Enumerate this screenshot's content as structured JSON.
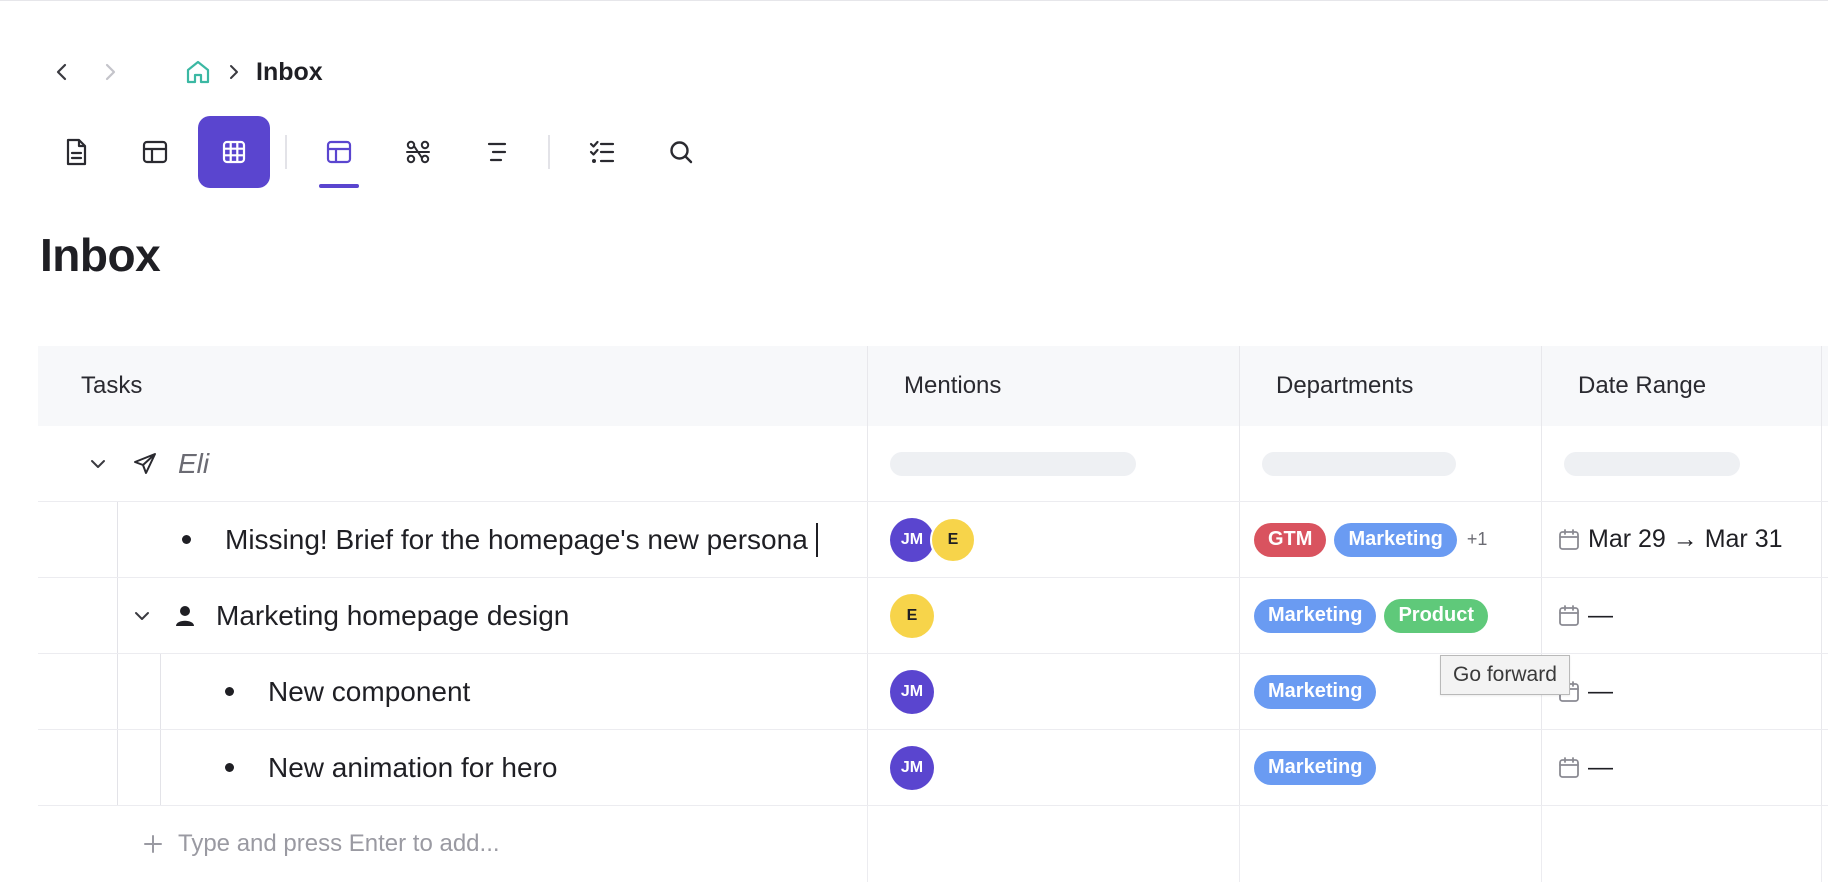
{
  "breadcrumb": {
    "current": "Inbox",
    "home_icon": "home-icon"
  },
  "toolbar": {
    "items": [
      {
        "name": "document-view",
        "icon": "document-icon"
      },
      {
        "name": "table-view",
        "icon": "table-icon"
      },
      {
        "name": "grid-view",
        "icon": "grid-icon",
        "active": true
      },
      {
        "name": "board-view",
        "icon": "layout-icon",
        "tab_active": true
      },
      {
        "name": "graph-view",
        "icon": "graph-icon"
      },
      {
        "name": "outline-view",
        "icon": "outline-icon"
      },
      {
        "name": "checklist-view",
        "icon": "checklist-icon"
      },
      {
        "name": "search",
        "icon": "search-icon"
      }
    ],
    "accent": "#5a45cf"
  },
  "page": {
    "title": "Inbox"
  },
  "table": {
    "columns": [
      "Tasks",
      "Mentions",
      "Departments",
      "Date Range"
    ],
    "group": {
      "label": "Eli"
    },
    "rows": [
      {
        "task": "Missing! Brief for the homepage's new persona",
        "mentions": [
          "JM",
          "E"
        ],
        "departments": [
          "GTM",
          "Marketing"
        ],
        "more": "+1",
        "date": "Mar 29 → Mar 31"
      },
      {
        "task": "Marketing homepage design",
        "mentions": [
          "E"
        ],
        "departments": [
          "Marketing",
          "Product"
        ],
        "date": "—"
      },
      {
        "task": "New component",
        "mentions": [
          "JM"
        ],
        "departments": [
          "Marketing"
        ],
        "date": "—"
      },
      {
        "task": "New animation for hero",
        "mentions": [
          "JM"
        ],
        "departments": [
          "Marketing"
        ],
        "date": "—"
      }
    ],
    "add_placeholder": "Type and press Enter to add..."
  },
  "tag_colors": {
    "GTM": "#d9535f",
    "Marketing": "#6a9bf2",
    "Product": "#5fc97a"
  },
  "tooltip": "Go forward"
}
